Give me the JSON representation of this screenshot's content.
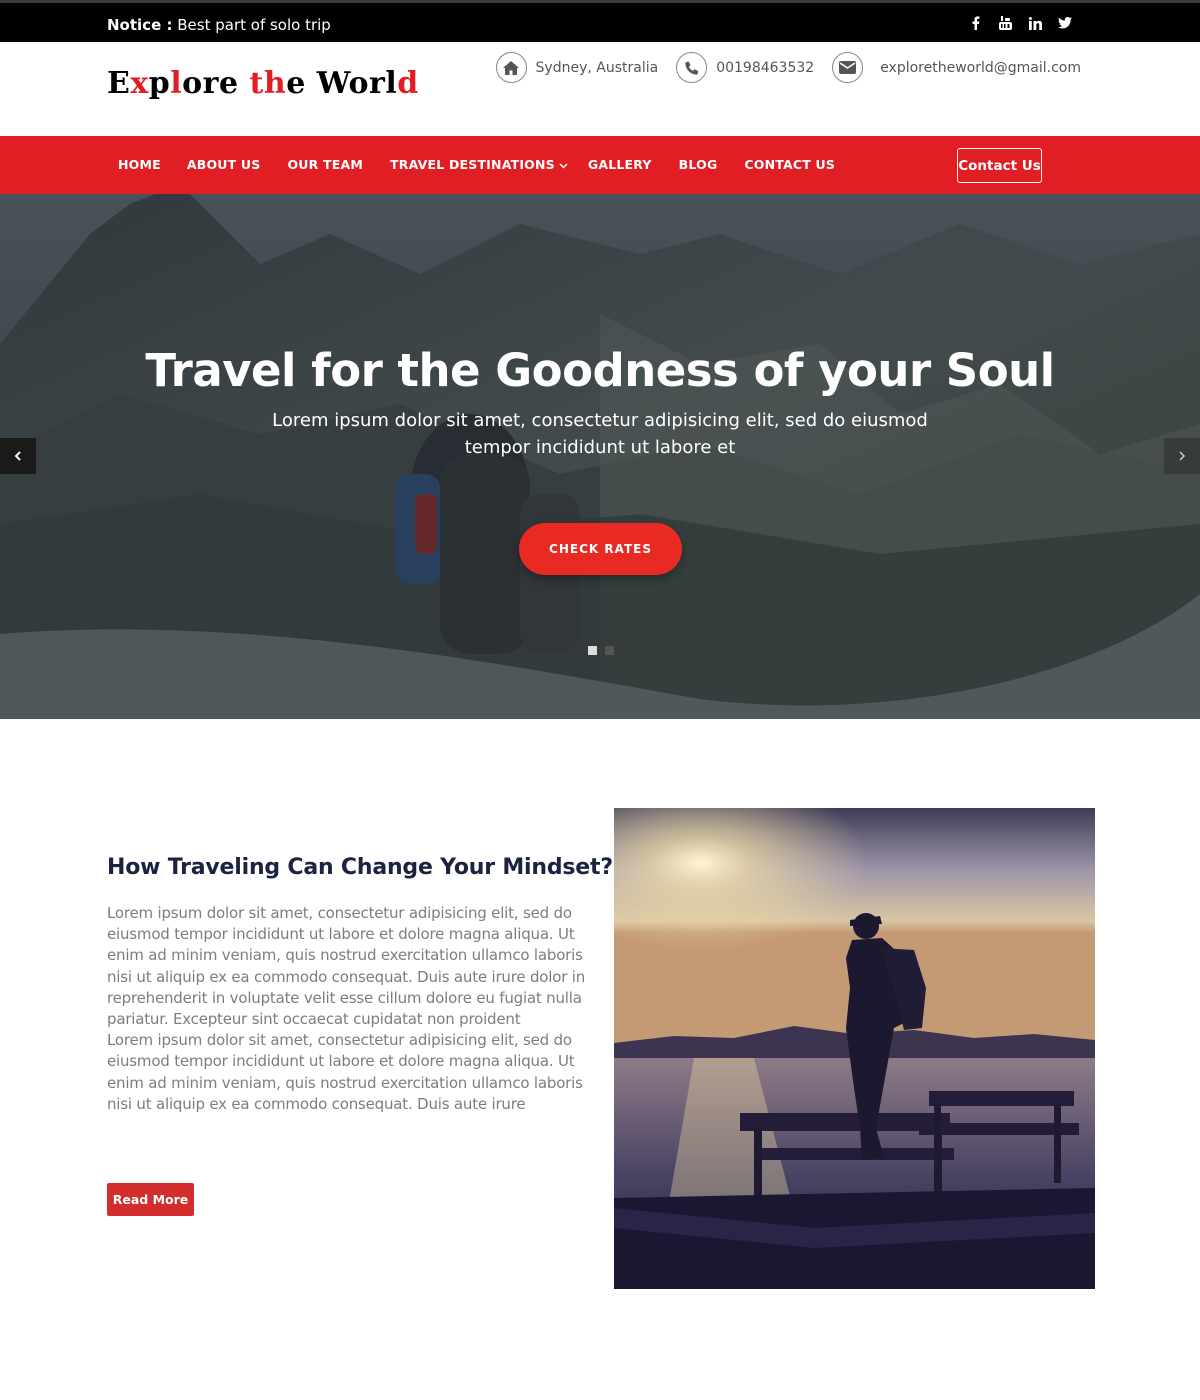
{
  "topbar": {
    "notice_label": "Notice :",
    "notice_text": "Best part of solo trip",
    "socials": [
      "facebook-icon",
      "youtube-icon",
      "linkedin-icon",
      "twitter-icon"
    ]
  },
  "header": {
    "logo": "Explore the World",
    "location": "Sydney, Australia",
    "phone": "00198463532",
    "email": "exploretheworld@gmail.com"
  },
  "nav": {
    "items": [
      "HOME",
      "ABOUT US",
      "OUR TEAM",
      "TRAVEL DESTINATIONS",
      "GALLERY",
      "BLOG",
      "CONTACT US"
    ],
    "cta": "Contact Us"
  },
  "hero": {
    "title": "Travel for the Goodness of your Soul",
    "subtitle": "Lorem ipsum dolor sit amet, consectetur adipisicing elit, sed do eiusmod tempor incididunt ut labore et",
    "button": "CHECK RATES",
    "slide_count": 2,
    "active_slide": 1
  },
  "about": {
    "title": "How Traveling Can Change Your Mindset?",
    "paragraph1": "Lorem ipsum dolor sit amet, consectetur adipisicing elit, sed do eiusmod tempor incididunt ut labore et dolore magna aliqua. Ut enim ad minim veniam, quis nostrud exercitation ullamco laboris nisi ut aliquip ex ea commodo consequat. Duis aute irure dolor in reprehenderit in voluptate velit esse cillum dolore eu fugiat nulla pariatur. Excepteur sint occaecat cupidatat non proident",
    "paragraph2": "Lorem ipsum dolor sit amet, consectetur adipisicing elit, sed do eiusmod tempor incididunt ut labore et dolore magna aliqua. Ut enim ad minim veniam, quis nostrud exercitation ullamco laboris nisi ut aliquip ex ea commodo consequat. Duis aute irure",
    "button": "Read More"
  },
  "colors": {
    "accent": "#e01e24",
    "dark": "#000000",
    "heading": "#1c2340"
  }
}
